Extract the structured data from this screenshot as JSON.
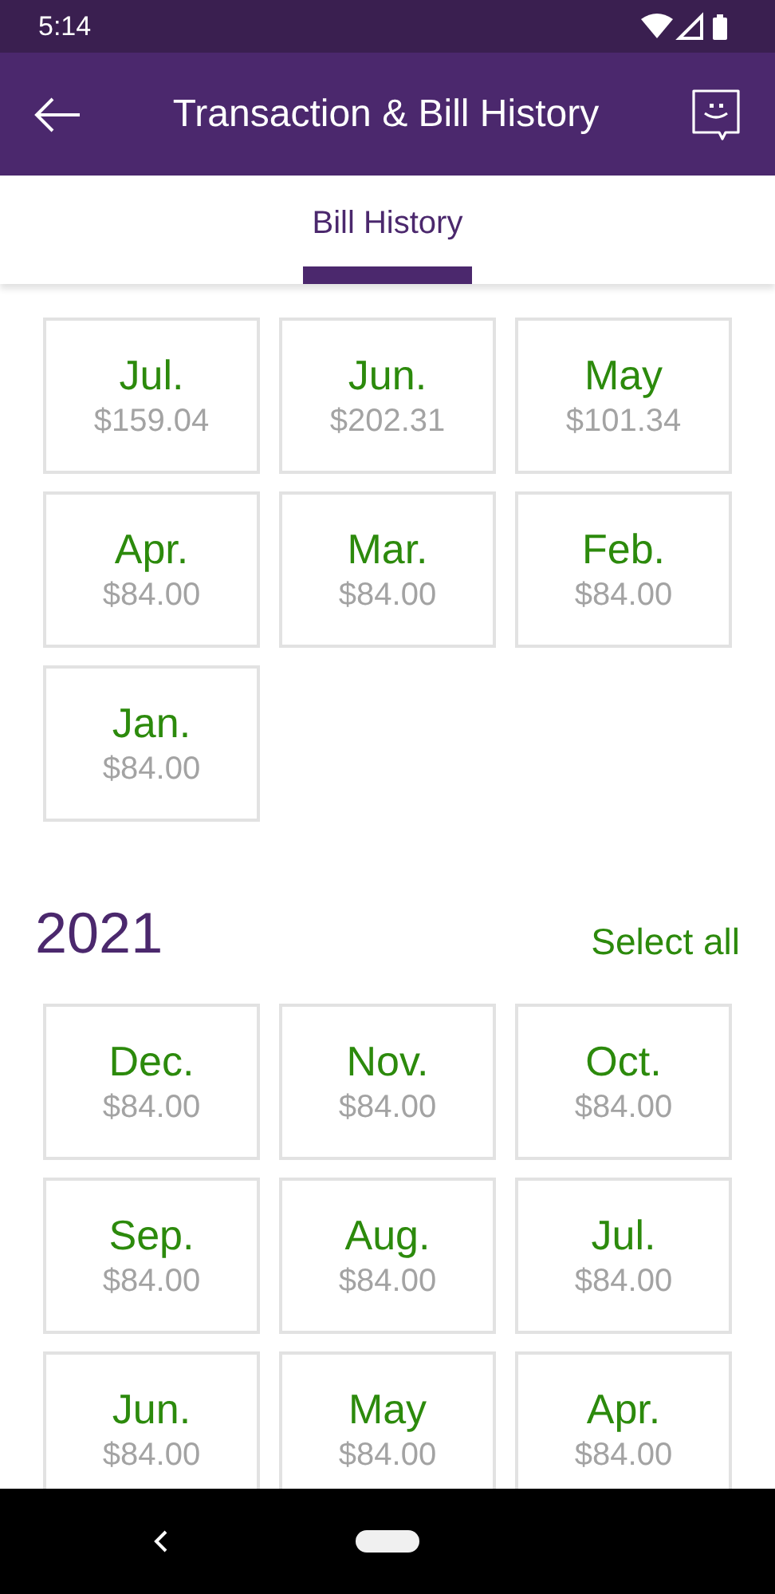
{
  "status_bar": {
    "time": "5:14"
  },
  "header": {
    "title": "Transaction & Bill History"
  },
  "tabs": [
    {
      "label": "Bill History",
      "selected": true
    }
  ],
  "sections": [
    {
      "bills": [
        {
          "month": "Jul.",
          "amount": "$159.04"
        },
        {
          "month": "Jun.",
          "amount": "$202.31"
        },
        {
          "month": "May",
          "amount": "$101.34"
        },
        {
          "month": "Apr.",
          "amount": "$84.00"
        },
        {
          "month": "Mar.",
          "amount": "$84.00"
        },
        {
          "month": "Feb.",
          "amount": "$84.00"
        },
        {
          "month": "Jan.",
          "amount": "$84.00"
        }
      ]
    },
    {
      "year": "2021",
      "action": "Select all",
      "bills": [
        {
          "month": "Dec.",
          "amount": "$84.00"
        },
        {
          "month": "Nov.",
          "amount": "$84.00"
        },
        {
          "month": "Oct.",
          "amount": "$84.00"
        },
        {
          "month": "Sep.",
          "amount": "$84.00"
        },
        {
          "month": "Aug.",
          "amount": "$84.00"
        },
        {
          "month": "Jul.",
          "amount": "$84.00"
        },
        {
          "month": "Jun.",
          "amount": "$84.00"
        },
        {
          "month": "May",
          "amount": "$84.00"
        },
        {
          "month": "Apr.",
          "amount": "$84.00"
        }
      ]
    }
  ]
}
